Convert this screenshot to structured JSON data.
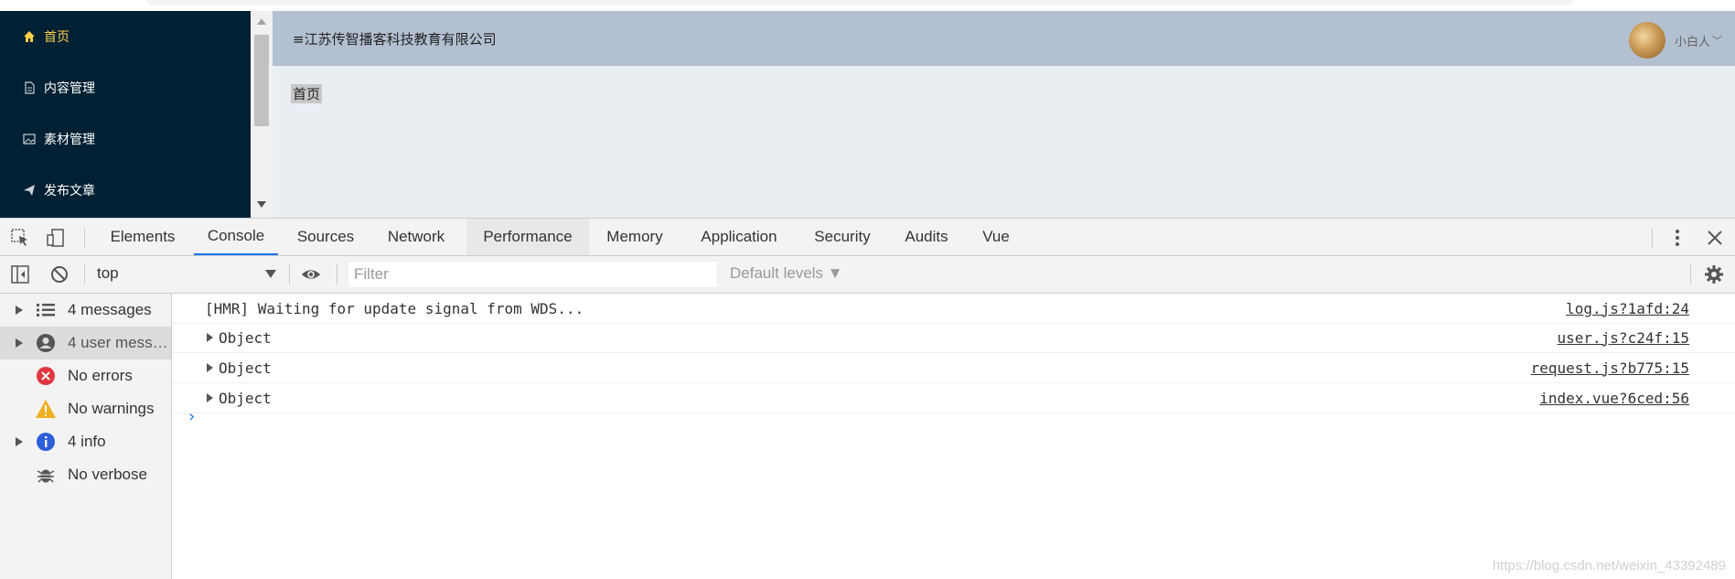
{
  "app": {
    "sidebar": {
      "items": [
        {
          "label": "首页",
          "icon": "home-icon",
          "active": true
        },
        {
          "label": "内容管理",
          "icon": "document-icon",
          "active": false
        },
        {
          "label": "素材管理",
          "icon": "image-icon",
          "active": false
        },
        {
          "label": "发布文章",
          "icon": "send-icon",
          "active": false
        }
      ]
    },
    "header": {
      "company": "≡江苏传智播客科技教育有限公司",
      "user_name": "小白人",
      "user_chevron": "﹀"
    },
    "main": {
      "text": "首页"
    },
    "colors": {
      "sidebar_bg": "#002033",
      "active": "#ffd04b",
      "header_bg": "#b3c0d1",
      "main_bg": "#e9eef3"
    }
  },
  "devtools": {
    "tabs": [
      "Elements",
      "Console",
      "Sources",
      "Network",
      "Performance",
      "Memory",
      "Application",
      "Security",
      "Audits",
      "Vue"
    ],
    "active_tab": "Console",
    "context": "top",
    "filter_placeholder": "Filter",
    "levels": "Default levels ▼",
    "sidebar": [
      {
        "label": "4 messages",
        "icon": "list-icon",
        "has_arrow": true
      },
      {
        "label": "4 user mess…",
        "icon": "user-icon",
        "has_arrow": true
      },
      {
        "label": "No errors",
        "icon": "error-icon",
        "has_arrow": false
      },
      {
        "label": "No warnings",
        "icon": "warning-icon",
        "has_arrow": false
      },
      {
        "label": "4 info",
        "icon": "info-icon",
        "has_arrow": true
      },
      {
        "label": "No verbose",
        "icon": "bug-icon",
        "has_arrow": false
      }
    ],
    "logs": [
      {
        "text": "[HMR] Waiting for update signal from WDS...",
        "source": "log.js?1afd:24",
        "expandable": false
      },
      {
        "text": "Object",
        "source": "user.js?c24f:15",
        "expandable": true
      },
      {
        "text": "Object",
        "source": "request.js?b775:15",
        "expandable": true
      },
      {
        "text": "Object",
        "source": "index.vue?6ced:56",
        "expandable": true
      }
    ],
    "prompt": "›"
  },
  "watermark": "https://blog.csdn.net/weixin_43392489"
}
